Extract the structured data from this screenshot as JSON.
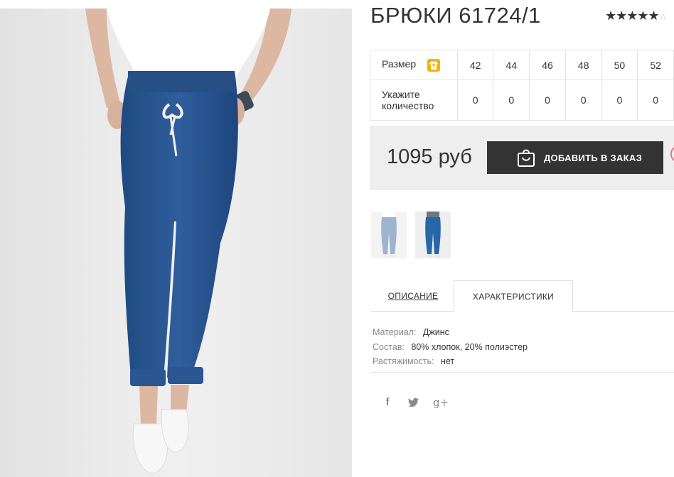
{
  "product": {
    "title": "БРЮКИ 61724/1",
    "rating": 4.5,
    "rating_stars": "★★★★",
    "rating_half": "★",
    "rating_empty": "☆"
  },
  "sizes": {
    "size_label": "Размер",
    "size_icon": "shirt-size-icon",
    "qty_label_line1": "Укажите",
    "qty_label_line2": "количество",
    "values": [
      "42",
      "44",
      "46",
      "48",
      "50",
      "52"
    ],
    "quantities": [
      "0",
      "0",
      "0",
      "0",
      "0",
      "0"
    ]
  },
  "price": {
    "text": "1095 руб",
    "button_label": "ДОБАВИТЬ В ЗАКАЗ"
  },
  "tabs": {
    "description": "ОПИСАНИЕ",
    "characteristics": "ХАРАКТЕРИСТИКИ",
    "active": "characteristics"
  },
  "properties": [
    {
      "key": "Материал:",
      "value": "Джинс"
    },
    {
      "key": "Состав:",
      "value": "80% хлопок, 20% полиэстер"
    },
    {
      "key": "Растяжимость:",
      "value": "нет"
    }
  ],
  "social": {
    "facebook": "f",
    "twitter": "🐦",
    "googleplus": "g+"
  },
  "colors": {
    "accent_button": "#333333",
    "price_bg": "#eeeeee",
    "size_icon": "#f5b400",
    "denim": "#2d5a94"
  }
}
